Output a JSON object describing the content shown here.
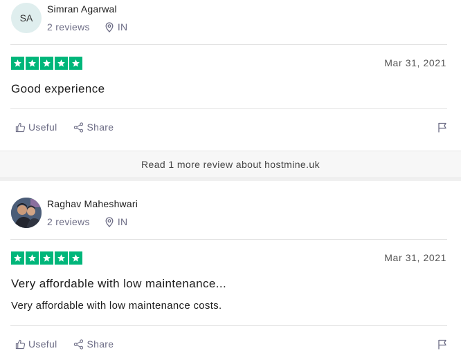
{
  "reviews": [
    {
      "reviewer_initials": "SA",
      "reviewer_name": "Simran Agarwal",
      "review_count": "2 reviews",
      "country": "IN",
      "rating": 5,
      "date": "Mar 31, 2021",
      "title": "Good experience",
      "text": "",
      "useful_label": "Useful",
      "share_label": "Share"
    },
    {
      "reviewer_initials": "",
      "reviewer_name": "Raghav Maheshwari",
      "review_count": "2 reviews",
      "country": "IN",
      "rating": 5,
      "date": "Mar 31, 2021",
      "title": "Very affordable with low maintenance...",
      "text": "Very affordable with low maintenance costs.",
      "useful_label": "Useful",
      "share_label": "Share"
    }
  ],
  "read_more_label": "Read 1 more review about hostmine.uk",
  "colors": {
    "star_green": "#00b67a",
    "muted_text": "#6c6c85",
    "avatar_bg": "#dfeeee"
  }
}
